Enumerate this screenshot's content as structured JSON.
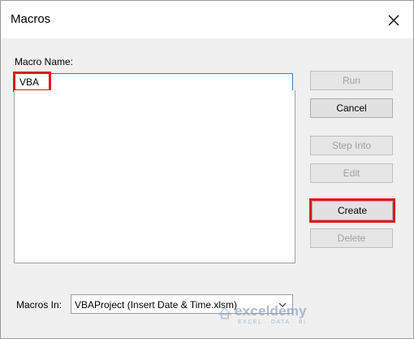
{
  "window": {
    "title": "Macros"
  },
  "macro_name": {
    "label": "Macro Name:",
    "value": "VBA"
  },
  "buttons": {
    "run": "Run",
    "cancel": "Cancel",
    "step_into": "Step Into",
    "edit": "Edit",
    "create": "Create",
    "delete": "Delete"
  },
  "macros_in": {
    "label": "Macros In:",
    "selected": "VBAProject (Insert Date & Time.xlsm)"
  },
  "watermark": {
    "name": "exceldemy",
    "tagline": "EXCEL · DATA · BI"
  },
  "colors": {
    "highlight": "#e0181b",
    "accent": "#3c7fb1"
  }
}
